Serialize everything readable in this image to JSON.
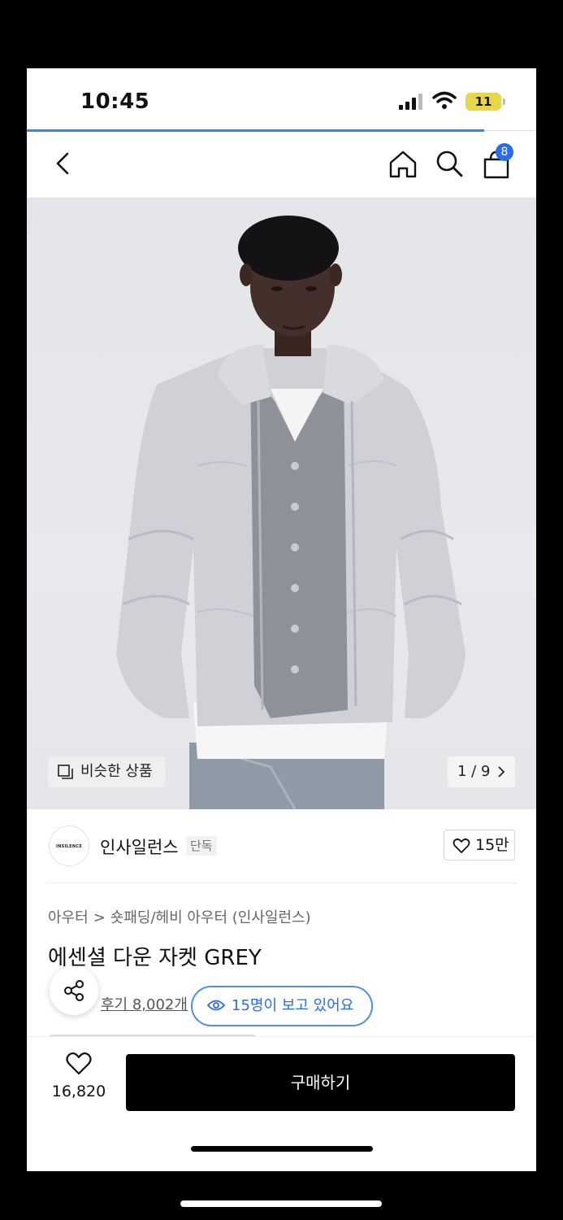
{
  "status": {
    "time": "10:45",
    "battery": "11"
  },
  "header": {
    "cart_count": "8"
  },
  "gallery": {
    "similar_label": "비슷한 상품",
    "pager": "1 / 9",
    "image_alt": "man wearing grey down jacket over grey cardigan"
  },
  "brand": {
    "logo_text": "INSILENCE",
    "name": "인사일런스",
    "tag": "단독",
    "likes": "15만"
  },
  "breadcrumb": [
    "아우터",
    ">",
    "숏패딩/헤비 아우터 (인사일런스)"
  ],
  "product": {
    "title": "에센셜 다운 자켓 GREY",
    "reviews": "후기 8,002개",
    "viewers": "15명이 보고 있어요"
  },
  "bottom": {
    "wish_count": "16,820",
    "buy_label": "구매하기"
  },
  "colors": {
    "accent": "#2a6bea",
    "buy": "#000000"
  }
}
